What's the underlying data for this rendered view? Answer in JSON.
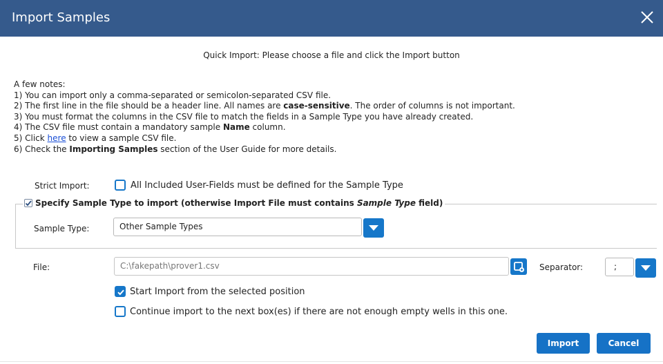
{
  "dialog": {
    "title": "Import Samples",
    "subtitle": "Quick Import: Please choose a file and click the Import button"
  },
  "notes": {
    "heading": "A few notes:",
    "line1": "1) You can import only a comma-separated or semicolon-separated CSV file.",
    "line2_pre": "2) The first line in the file should be a header line. All names are ",
    "line2_bold": "case-sensitive",
    "line2_post": ". The order of columns is not important.",
    "line3": "3) You must format the columns in the CSV file to match the fields in a Sample Type you have already created.",
    "line4_pre": "4) The CSV file must contain a mandatory sample ",
    "line4_bold": "Name",
    "line4_post": " column.",
    "line5_pre": "5) Click ",
    "line5_link": "here",
    "line5_post": " to view a sample CSV file.",
    "line6_pre": "6) Check the ",
    "line6_bold": "Importing Samples",
    "line6_post": " section of the User Guide for more details."
  },
  "strict_import": {
    "label": "Strict Import:",
    "checkbox_label": "All Included User-Fields must be defined for the Sample Type",
    "checked": false
  },
  "specify_type": {
    "legend_pre": "Specify Sample Type to import (otherwise Import File must contains ",
    "legend_italic": "Sample Type",
    "legend_post": " field)",
    "checked": true,
    "sample_type_label": "Sample Type:",
    "sample_type_value": "Other Sample Types"
  },
  "file": {
    "label": "File:",
    "value": "C:\\fakepath\\prover1.csv",
    "separator_label": "Separator:",
    "separator_value": ";"
  },
  "options": {
    "start_from_selected": "Start Import from the selected position",
    "start_checked": true,
    "continue_next_box": "Continue import to the next box(es) if there are not enough empty wells in this one.",
    "continue_checked": false
  },
  "buttons": {
    "import": "Import",
    "cancel": "Cancel"
  },
  "colors": {
    "titlebar": "#355a8c",
    "accent": "#1677c9"
  }
}
